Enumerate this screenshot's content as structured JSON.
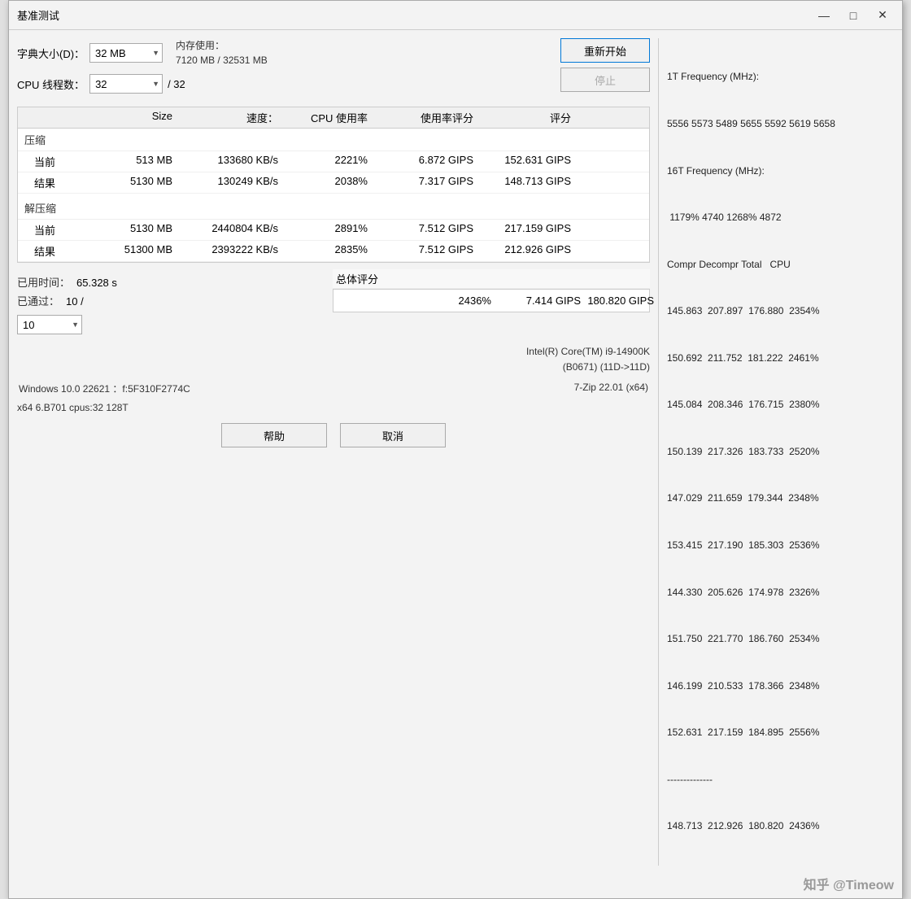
{
  "window": {
    "title": "基准测试"
  },
  "controls": {
    "dict_size_label": "字典大小(D)：",
    "dict_size_value": "32 MB",
    "cpu_threads_label": "CPU 线程数：",
    "cpu_threads_value": "32",
    "cpu_threads_max": "/ 32",
    "mem_line1": "内存使用：",
    "mem_line2": "7120 MB / 32531 MB",
    "btn_restart": "重新开始",
    "btn_stop": "停止"
  },
  "table": {
    "headers": [
      "",
      "Size",
      "速度：",
      "CPU 使用率",
      "使用率评分",
      "评分"
    ],
    "compress_title": "压缩",
    "decompress_title": "解压缩",
    "compress_rows": [
      {
        "label": "当前",
        "size": "513 MB",
        "speed": "133680 KB/s",
        "cpu": "2221%",
        "rating": "6.872 GIPS",
        "score": "152.631 GIPS"
      },
      {
        "label": "结果",
        "size": "5130 MB",
        "speed": "130249 KB/s",
        "cpu": "2038%",
        "rating": "7.317 GIPS",
        "score": "148.713 GIPS"
      }
    ],
    "decompress_rows": [
      {
        "label": "当前",
        "size": "5130 MB",
        "speed": "2440804 KB/s",
        "cpu": "2891%",
        "rating": "7.512 GIPS",
        "score": "217.159 GIPS"
      },
      {
        "label": "结果",
        "size": "51300 MB",
        "speed": "2393222 KB/s",
        "cpu": "2835%",
        "rating": "7.512 GIPS",
        "score": "212.926 GIPS"
      }
    ]
  },
  "bottom": {
    "elapsed_label": "已用时间：",
    "elapsed_value": "65.328 s",
    "passed_label": "已通过：",
    "passed_value": "10 /",
    "pass_select": "10",
    "total_label": "总体评分",
    "total_cpu": "2436%",
    "total_rating": "7.414 GIPS",
    "total_score": "180.820 GIPS"
  },
  "right_panel": {
    "freq_1t_label": "1T Frequency (MHz):",
    "freq_1t_values": "5556 5573 5489 5655 5592 5619 5658",
    "freq_16t_label": "16T Frequency (MHz):",
    "freq_16t_values": " 1179% 4740 1268% 4872",
    "col_header": "Compr Decompr Total   CPU",
    "rows": [
      "145.863  207.897  176.880  2354%",
      "150.692  211.752  181.222  2461%",
      "145.084  208.346  176.715  2380%",
      "150.139  217.326  183.733  2520%",
      "147.029  211.659  179.344  2348%",
      "153.415  217.190  185.303  2536%",
      "144.330  205.626  174.978  2326%",
      "151.750  221.770  186.760  2534%",
      "146.199  210.533  178.366  2348%",
      "152.631  217.159  184.895  2556%"
    ],
    "divider": "--------------",
    "total_row": "148.713  212.926  180.820  2436%"
  },
  "footer": {
    "cpu_line1": "Intel(R) Core(TM) i9-14900K",
    "cpu_line2": "(B0671) (11D->11D)",
    "os_info": "Windows 10.0 22621 ：f:5F310F2774C",
    "zip_info": "7-Zip 22.01 (x64)",
    "arch_info": "x64 6.B701 cpus:32 128T",
    "btn_help": "帮助",
    "btn_cancel": "取消"
  },
  "watermark": "知乎 @Timeow"
}
